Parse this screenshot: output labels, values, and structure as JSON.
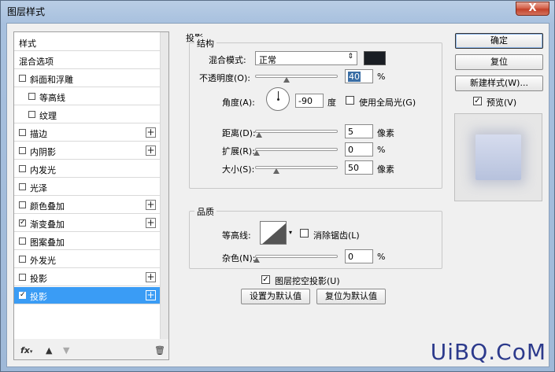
{
  "window": {
    "title": "图层样式",
    "close_label": "X"
  },
  "style_list": {
    "items": [
      {
        "label": "样式",
        "checkbox": false,
        "checked": false,
        "plus": false,
        "indent": 0,
        "selected": false
      },
      {
        "label": "混合选项",
        "checkbox": false,
        "checked": false,
        "plus": false,
        "indent": 0,
        "selected": false
      },
      {
        "label": "斜面和浮雕",
        "checkbox": true,
        "checked": false,
        "plus": false,
        "indent": 0,
        "selected": false
      },
      {
        "label": "等高线",
        "checkbox": true,
        "checked": false,
        "plus": false,
        "indent": 1,
        "selected": false
      },
      {
        "label": "纹理",
        "checkbox": true,
        "checked": false,
        "plus": false,
        "indent": 1,
        "selected": false
      },
      {
        "label": "描边",
        "checkbox": true,
        "checked": false,
        "plus": true,
        "indent": 0,
        "selected": false
      },
      {
        "label": "内阴影",
        "checkbox": true,
        "checked": false,
        "plus": true,
        "indent": 0,
        "selected": false
      },
      {
        "label": "内发光",
        "checkbox": true,
        "checked": false,
        "plus": false,
        "indent": 0,
        "selected": false
      },
      {
        "label": "光泽",
        "checkbox": true,
        "checked": false,
        "plus": false,
        "indent": 0,
        "selected": false
      },
      {
        "label": "颜色叠加",
        "checkbox": true,
        "checked": false,
        "plus": true,
        "indent": 0,
        "selected": false
      },
      {
        "label": "渐变叠加",
        "checkbox": true,
        "checked": true,
        "plus": true,
        "indent": 0,
        "selected": false
      },
      {
        "label": "图案叠加",
        "checkbox": true,
        "checked": false,
        "plus": false,
        "indent": 0,
        "selected": false
      },
      {
        "label": "外发光",
        "checkbox": true,
        "checked": false,
        "plus": false,
        "indent": 0,
        "selected": false
      },
      {
        "label": "投影",
        "checkbox": true,
        "checked": false,
        "plus": true,
        "indent": 0,
        "selected": false
      },
      {
        "label": "投影",
        "checkbox": true,
        "checked": true,
        "plus": true,
        "indent": 0,
        "selected": true
      }
    ],
    "bottom_icons": [
      "fx",
      "up-arrow",
      "down-arrow",
      "trash"
    ]
  },
  "panel": {
    "section_title": "投影",
    "structure": {
      "title": "结构",
      "blend_mode_label": "混合模式:",
      "blend_mode_value": "正常",
      "shadow_color": "#1a1e24",
      "opacity_label": "不透明度(O):",
      "opacity_value": "40",
      "opacity_unit": "%",
      "opacity_level": 0.4,
      "angle_label": "角度(A):",
      "angle_value": "-90",
      "angle_unit": "度",
      "global_light_label": "使用全局光(G)",
      "global_light_checked": false,
      "distance_label": "距离(D):",
      "distance_value": "5",
      "distance_unit": "像素",
      "spread_label": "扩展(R):",
      "spread_value": "0",
      "spread_unit": "%",
      "size_label": "大小(S):",
      "size_value": "50",
      "size_unit": "像素"
    },
    "quality": {
      "title": "品质",
      "contour_label": "等高线:",
      "antialias_label": "消除锯齿(L)",
      "antialias_checked": false,
      "noise_label": "杂色(N):",
      "noise_value": "0",
      "noise_unit": "%"
    },
    "knockout_label": "图层挖空投影(U)",
    "knockout_checked": true,
    "make_default_label": "设置为默认值",
    "reset_default_label": "复位为默认值"
  },
  "right": {
    "ok_label": "确定",
    "reset_label": "复位",
    "new_style_label": "新建样式(W)...",
    "preview_label": "预览(V)",
    "preview_checked": true
  },
  "watermark": "UiBQ.CoM"
}
